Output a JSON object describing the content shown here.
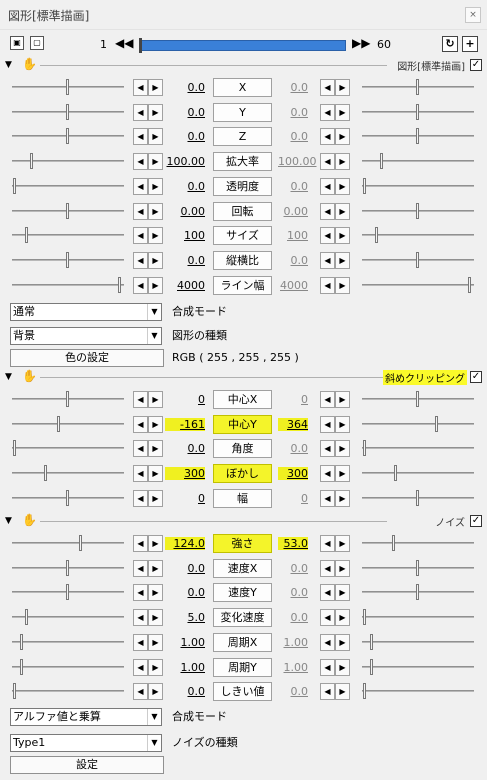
{
  "window": {
    "title": "図形[標準描画]",
    "close_icon": "×"
  },
  "toolbar": {
    "frame_start": "1",
    "frame_end": "60",
    "prev_label": "◀◀",
    "next_label": "▶▶",
    "play_label": "↻",
    "add_label": "+"
  },
  "sections": [
    {
      "title": "図形[標準描画]",
      "highlight": false,
      "checked": true,
      "rows": [
        {
          "name": "X",
          "left": "0.0",
          "right": "0.0",
          "lthumb": 0.5,
          "rthumb": 0.5,
          "hl": false
        },
        {
          "name": "Y",
          "left": "0.0",
          "right": "0.0",
          "lthumb": 0.5,
          "rthumb": 0.5,
          "hl": false
        },
        {
          "name": "Z",
          "left": "0.0",
          "right": "0.0",
          "lthumb": 0.5,
          "rthumb": 0.5,
          "hl": false
        },
        {
          "name": "拡大率",
          "left": "100.00",
          "right": "100.00",
          "lthumb": 0.17,
          "rthumb": 0.17,
          "hl": false
        },
        {
          "name": "透明度",
          "left": "0.0",
          "right": "0.0",
          "lthumb": 0.01,
          "rthumb": 0.01,
          "hl": false
        },
        {
          "name": "回転",
          "left": "0.00",
          "right": "0.00",
          "lthumb": 0.5,
          "rthumb": 0.5,
          "hl": false
        },
        {
          "name": "サイズ",
          "left": "100",
          "right": "100",
          "lthumb": 0.12,
          "rthumb": 0.12,
          "hl": false
        },
        {
          "name": "縦横比",
          "left": "0.0",
          "right": "0.0",
          "lthumb": 0.5,
          "rthumb": 0.5,
          "hl": false
        },
        {
          "name": "ライン幅",
          "left": "4000",
          "right": "4000",
          "lthumb": 0.98,
          "rthumb": 0.98,
          "hl": false
        }
      ]
    },
    {
      "title": "斜めクリッピング",
      "highlight": true,
      "checked": true,
      "rows": [
        {
          "name": "中心X",
          "left": "0",
          "right": "0",
          "lthumb": 0.5,
          "rthumb": 0.5,
          "hl": false
        },
        {
          "name": "中心Y",
          "left": "-161",
          "right": "364",
          "lthumb": 0.42,
          "rthumb": 0.68,
          "hl": true
        },
        {
          "name": "角度",
          "left": "0.0",
          "right": "0.0",
          "lthumb": 0.01,
          "rthumb": 0.01,
          "hl": false
        },
        {
          "name": "ぼかし",
          "left": "300",
          "right": "300",
          "lthumb": 0.3,
          "rthumb": 0.3,
          "hl": true
        },
        {
          "name": "幅",
          "left": "0",
          "right": "0",
          "lthumb": 0.5,
          "rthumb": 0.5,
          "hl": false
        }
      ]
    },
    {
      "title": "ノイズ",
      "highlight": false,
      "checked": true,
      "rows": [
        {
          "name": "強さ",
          "left": "124.0",
          "right": "53.0",
          "lthumb": 0.62,
          "rthumb": 0.28,
          "hl": true
        },
        {
          "name": "速度X",
          "left": "0.0",
          "right": "0.0",
          "lthumb": 0.5,
          "rthumb": 0.5,
          "hl": false
        },
        {
          "name": "速度Y",
          "left": "0.0",
          "right": "0.0",
          "lthumb": 0.5,
          "rthumb": 0.5,
          "hl": false
        },
        {
          "name": "変化速度",
          "left": "5.0",
          "right": "0.0",
          "lthumb": 0.12,
          "rthumb": 0.01,
          "hl": false
        },
        {
          "name": "周期X",
          "left": "1.00",
          "right": "1.00",
          "lthumb": 0.07,
          "rthumb": 0.07,
          "hl": false
        },
        {
          "name": "周期Y",
          "left": "1.00",
          "right": "1.00",
          "lthumb": 0.07,
          "rthumb": 0.07,
          "hl": false
        },
        {
          "name": "しきい値",
          "left": "0.0",
          "right": "0.0",
          "lthumb": 0.01,
          "rthumb": 0.01,
          "hl": false
        }
      ]
    }
  ],
  "shape_opts": {
    "blend_select": "通常",
    "blend_label": "合成モード",
    "shape_select": "背景",
    "shape_label": "図形の種類",
    "color_button": "色の設定",
    "rgb_text": "RGB ( 255 , 255 , 255 )"
  },
  "noise_opts": {
    "blend_select": "アルファ値と乗算",
    "blend_label": "合成モード",
    "type_select": "Type1",
    "type_label": "ノイズの種類",
    "settings_button": "設定"
  }
}
